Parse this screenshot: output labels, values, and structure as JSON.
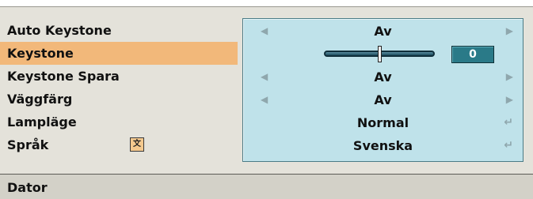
{
  "menu": {
    "items": [
      {
        "label": "Auto Keystone"
      },
      {
        "label": "Keystone"
      },
      {
        "label": "Keystone  Spara"
      },
      {
        "label": "Väggfärg"
      },
      {
        "label": "Lampläge"
      },
      {
        "label": "Språk"
      }
    ],
    "selected_index": 1
  },
  "icons": {
    "language": "language-icon",
    "left_arrow": "left-arrow-icon",
    "right_arrow": "right-arrow-icon",
    "enter": "enter-icon"
  },
  "values": {
    "auto_keystone": "Av",
    "keystone_value": "0",
    "keystone_level": 0.5,
    "keystone_spara": "Av",
    "vaggfarg": "Av",
    "lamplage": "Normal",
    "sprak": "Svenska"
  },
  "status": {
    "source": "Dator"
  },
  "colors": {
    "selected_highlight": "#f2b87a",
    "panel_background": "#bfe2ea",
    "slider_value_box": "#2a7a88"
  }
}
